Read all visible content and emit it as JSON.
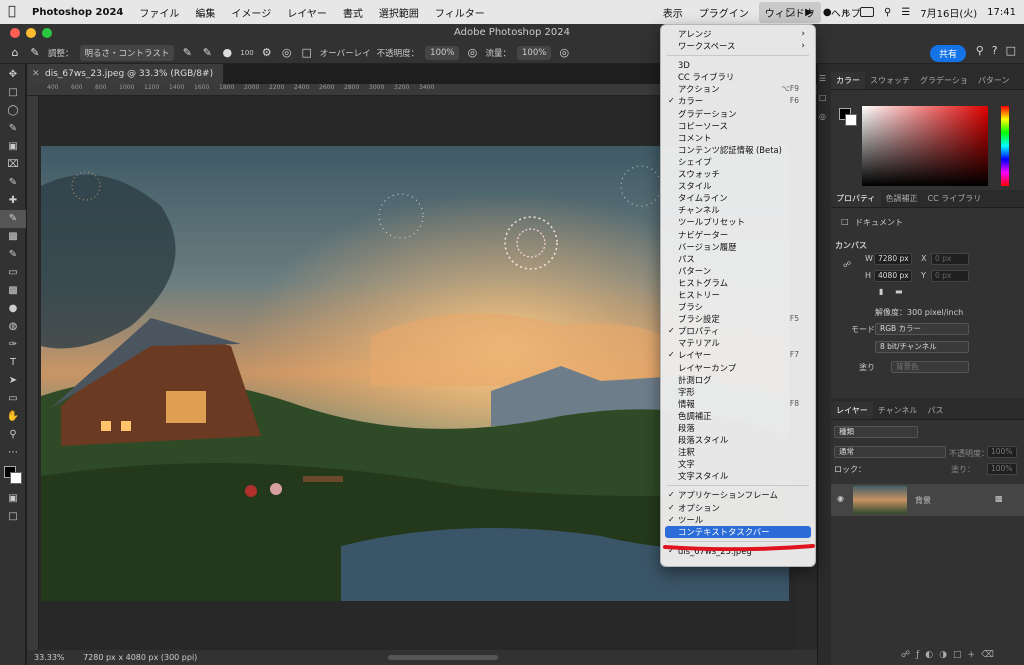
{
  "macmenu": {
    "app": "Photoshop 2024",
    "items": [
      "ファイル",
      "編集",
      "イメージ",
      "レイヤー",
      "書式",
      "選択範囲",
      "フィルター"
    ],
    "right_items": [
      "表示",
      "プラグイン"
    ],
    "active": "ウィンドウ",
    "help": "ヘルプ",
    "date": "7月16日(火)",
    "time": "17:41"
  },
  "window_title": "Adobe Photoshop 2024",
  "options": {
    "adjust_label": "調整：",
    "adjust_value": "明るさ・コントラスト",
    "brush_size": "100",
    "overlay": "オーバーレイ",
    "opacity_label": "不透明度：",
    "opacity_value": "100%",
    "flow_label": "流量：",
    "flow_value": "100%",
    "share": "共有"
  },
  "document": {
    "tab": "dis_67ws_23.jpeg @ 33.3% (RGB/8#)",
    "ruler_ticks": [
      "400",
      "600",
      "800",
      "1000",
      "1200",
      "1400",
      "1600",
      "1800",
      "2000",
      "2200",
      "2400",
      "2600",
      "2800",
      "3000",
      "3200",
      "3400"
    ]
  },
  "status": {
    "zoom": "33.33%",
    "info": "7280 px x 4080 px (300 ppi)"
  },
  "window_menu": {
    "top": [
      {
        "label": "アレンジ",
        "submenu": true
      },
      {
        "label": "ワークスペース",
        "submenu": true
      }
    ],
    "items": [
      {
        "label": "3D"
      },
      {
        "label": "CC ライブラリ"
      },
      {
        "label": "アクション",
        "shortcut": "⌥F9"
      },
      {
        "label": "カラー",
        "checked": true,
        "shortcut": "F6"
      },
      {
        "label": "グラデーション"
      },
      {
        "label": "コピーソース"
      },
      {
        "label": "コメント"
      },
      {
        "label": "コンテンツ認証情報 (Beta)"
      },
      {
        "label": "シェイプ"
      },
      {
        "label": "スウォッチ"
      },
      {
        "label": "スタイル"
      },
      {
        "label": "タイムライン"
      },
      {
        "label": "チャンネル"
      },
      {
        "label": "ツールプリセット"
      },
      {
        "label": "ナビゲーター"
      },
      {
        "label": "バージョン履歴"
      },
      {
        "label": "パス"
      },
      {
        "label": "パターン"
      },
      {
        "label": "ヒストグラム"
      },
      {
        "label": "ヒストリー"
      },
      {
        "label": "ブラシ"
      },
      {
        "label": "ブラシ設定",
        "shortcut": "F5"
      },
      {
        "label": "プロパティ",
        "checked": true
      },
      {
        "label": "マテリアル"
      },
      {
        "label": "レイヤー",
        "checked": true,
        "shortcut": "F7"
      },
      {
        "label": "レイヤーカンプ"
      },
      {
        "label": "計測ログ"
      },
      {
        "label": "字形"
      },
      {
        "label": "情報",
        "shortcut": "F8"
      },
      {
        "label": "色調補正"
      },
      {
        "label": "段落"
      },
      {
        "label": "段落スタイル"
      },
      {
        "label": "注釈"
      },
      {
        "label": "文字"
      },
      {
        "label": "文字スタイル"
      }
    ],
    "bottom": [
      {
        "label": "アプリケーションフレーム",
        "checked": true
      },
      {
        "label": "オプション",
        "checked": true
      },
      {
        "label": "ツール",
        "checked": true
      },
      {
        "label": "コンテキストタスクバー",
        "highlight": true
      }
    ],
    "docs": [
      {
        "label": "dis_67ws_23.jpeg",
        "checked": true
      }
    ]
  },
  "color_panel": {
    "tabs": [
      "カラー",
      "スウォッチ",
      "グラデーショ",
      "パターン"
    ]
  },
  "properties": {
    "tabs": [
      "プロパティ",
      "色調補正",
      "CC ライブラリ"
    ],
    "doc_label": "ドキュメント",
    "canvas_label": "カンバス",
    "w_label": "W",
    "w_value": "7280 px",
    "h_label": "H",
    "h_value": "4080 px",
    "x_label": "X",
    "x_value": "0 px",
    "y_label": "Y",
    "y_value": "0 px",
    "resolution": "解像度：300 pixel/inch",
    "mode_label": "モード",
    "mode_value": "RGB カラー",
    "depth_value": "8 bit/チャンネル",
    "fill_label": "塗り",
    "fill_value": "背景色"
  },
  "layers": {
    "tabs": [
      "レイヤー",
      "チャンネル",
      "パス"
    ],
    "search": "種類",
    "blend": "通常",
    "opacity_label": "不透明度：",
    "opacity_value": "100%",
    "lock_label": "ロック：",
    "fill_label": "塗り：",
    "fill_value": "100%",
    "layer_name": "背景"
  }
}
